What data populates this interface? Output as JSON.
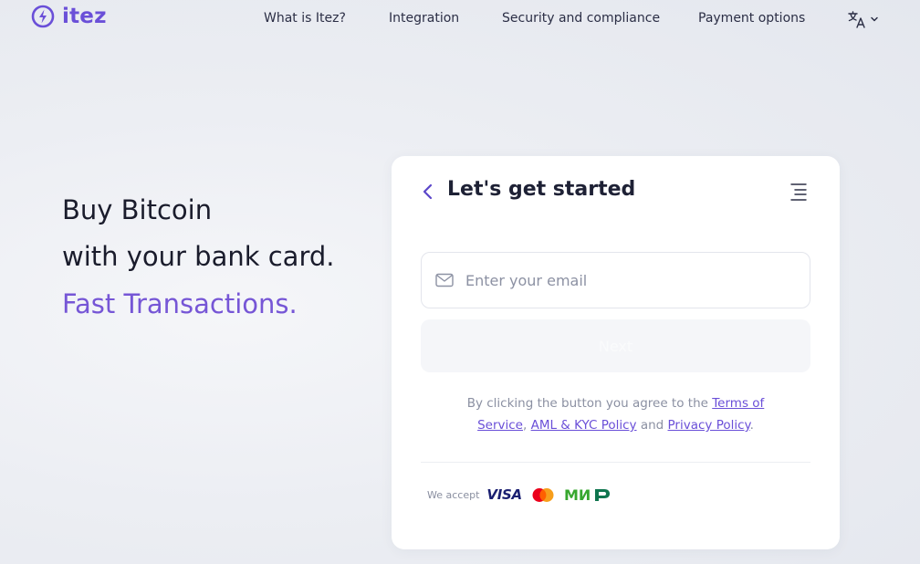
{
  "brand": {
    "name": "itez",
    "color": "#6a4fd8"
  },
  "nav": {
    "items": [
      {
        "label": "What is Itez?"
      },
      {
        "label": "Integration"
      },
      {
        "label": "Security and compliance"
      },
      {
        "label": "Payment options"
      }
    ],
    "language_icon": "translate-icon"
  },
  "hero": {
    "line1": "Buy Bitcoin",
    "line2": "with your bank card.",
    "accent": "Fast Transactions.",
    "accent_color": "#7656d6"
  },
  "form": {
    "title": "Let's get started",
    "email_placeholder": "Enter your email",
    "email_value": "",
    "next_label": "Next",
    "terms": {
      "prefix": "By clicking the button you agree to the ",
      "terms_link": "Terms of Service",
      "sep1": ", ",
      "aml_link": "AML & KYC Policy",
      "sep2": " and ",
      "privacy_link": "Privacy Policy",
      "suffix": "."
    },
    "accept_label": "We accept",
    "payment_methods": [
      "VISA",
      "Mastercard",
      "MIR"
    ],
    "visa_text": "VISA"
  }
}
